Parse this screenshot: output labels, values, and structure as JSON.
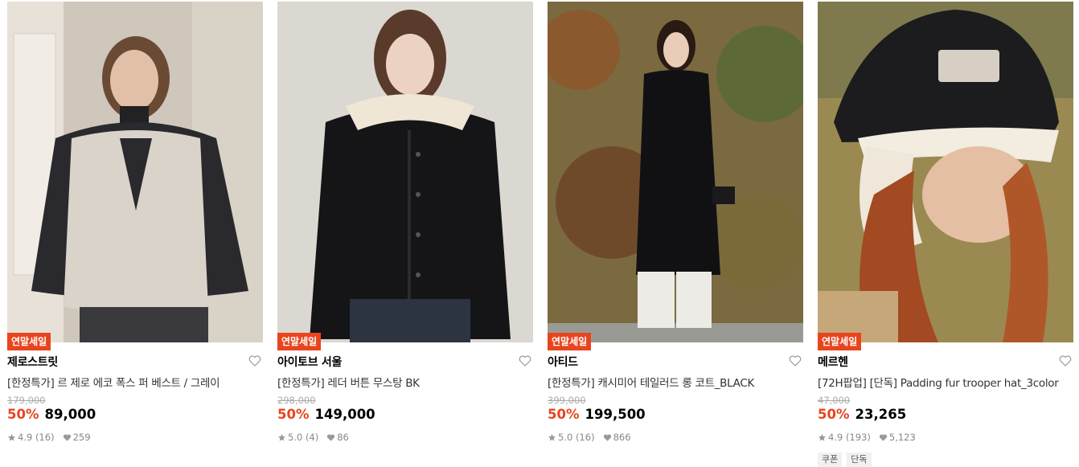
{
  "products": [
    {
      "badge": "연말세일",
      "brand": "제로스트릿",
      "title": "[한정특가] 르 제로 에코 폭스 퍼 베스트 / 그레이",
      "original_price": "179,000",
      "discount": "50%",
      "price": "89,000",
      "rating": "4.9 (16)",
      "likes": "259",
      "tags": []
    },
    {
      "badge": "연말세일",
      "brand": "아이토브 서울",
      "title": "[한정특가] 레더 버튼 무스탕 BK",
      "original_price": "298,000",
      "discount": "50%",
      "price": "149,000",
      "rating": "5.0 (4)",
      "likes": "86",
      "tags": []
    },
    {
      "badge": "연말세일",
      "brand": "아티드",
      "title": "[한정특가] 캐시미어 테일러드 롱 코트_BLACK",
      "original_price": "399,000",
      "discount": "50%",
      "price": "199,500",
      "rating": "5.0 (16)",
      "likes": "866",
      "tags": []
    },
    {
      "badge": "연말세일",
      "brand": "메르헨",
      "title": "[72H팝업] [단독] Padding fur trooper hat_3color",
      "original_price": "47,000",
      "discount": "50%",
      "price": "23,265",
      "rating": "4.9 (193)",
      "likes": "5,123",
      "tags": [
        "쿠폰",
        "단독"
      ]
    }
  ],
  "colors": {
    "accent": "#e8451e",
    "strike": "#aaaaaa",
    "meta": "#888888"
  }
}
